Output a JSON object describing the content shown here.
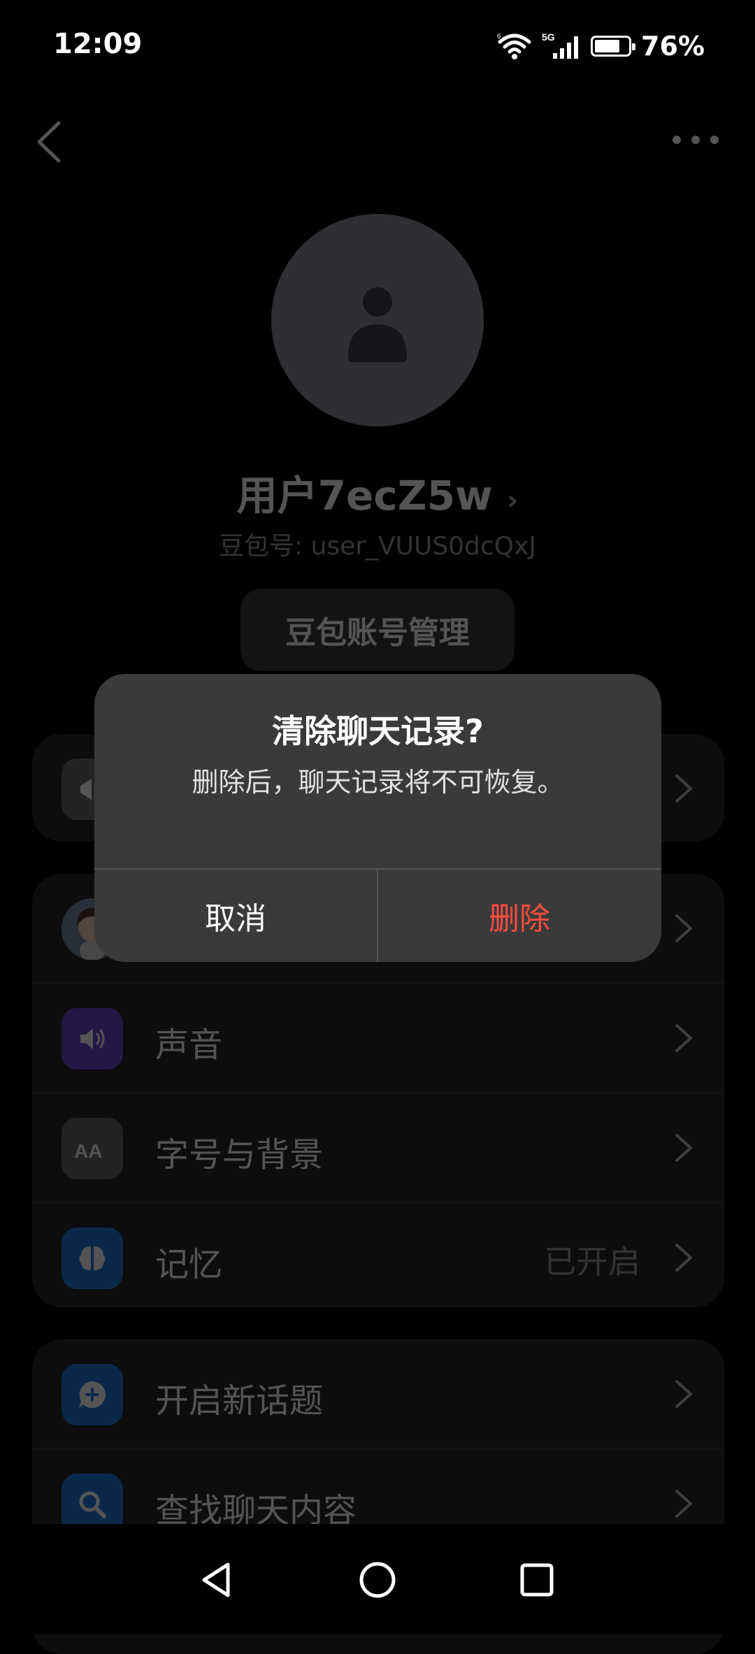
{
  "status_bar": {
    "time": "12:09",
    "battery_percent": "76%",
    "battery_level": 0.76
  },
  "profile": {
    "username": "用户7ecZ5w",
    "doubao_id": "豆包号: user_VUUS0dcQxJ",
    "account_button": "豆包账号管理"
  },
  "settings": {
    "group2": [
      {
        "label": "",
        "icon": "character-avatar-icon"
      },
      {
        "label": "声音",
        "icon": "speaker-icon",
        "color": "#6f4bd8"
      },
      {
        "label": "字号与背景",
        "icon": "font-size-icon",
        "color": "#6b6b6b"
      },
      {
        "label": "记忆",
        "value": "已开启",
        "icon": "memory-icon",
        "color": "#1f7be0"
      }
    ],
    "group3": [
      {
        "label": "开启新话题",
        "icon": "new-chat-icon",
        "color": "#1f7be0"
      },
      {
        "label": "查找聊天内容",
        "icon": "search-icon",
        "color": "#1f7be0"
      }
    ]
  },
  "dialog": {
    "title": "清除聊天记录?",
    "message": "删除后，聊天记录将不可恢复。",
    "cancel": "取消",
    "delete": "删除",
    "delete_color": "#ff4d3f"
  },
  "navbar": {
    "items": [
      "back-nav-icon",
      "home-nav-icon",
      "recents-nav-icon"
    ]
  }
}
